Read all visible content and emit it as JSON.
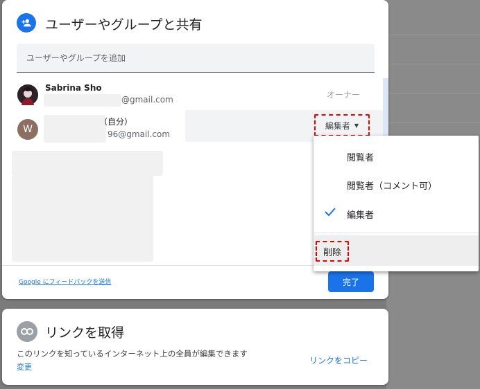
{
  "share_dialog": {
    "title": "ユーザーやグループと共有",
    "add_placeholder": "ユーザーやグループを追加",
    "people": [
      {
        "name": "Sabrina Sho",
        "email_suffix": "@gmail.com",
        "role": "オーナー"
      },
      {
        "avatar_letter": "W",
        "self_label": "（自分）",
        "email_suffix": "96@gmail.com",
        "role": "編集者"
      }
    ],
    "feedback_link": "Google にフィードバックを送信",
    "done_button": "完了"
  },
  "role_menu": {
    "items": [
      {
        "label": "閲覧者",
        "checked": false
      },
      {
        "label": "閲覧者（コメント可）",
        "checked": false
      },
      {
        "label": "編集者",
        "checked": true
      }
    ],
    "remove_label": "削除"
  },
  "link_card": {
    "title": "リンクを取得",
    "description": "このリンクを知っているインターネット上の全員が編集できます",
    "change_link": "変更",
    "copy_link": "リンクをコピー"
  },
  "colors": {
    "accent": "#1a73e8",
    "annotation": "#e00000",
    "overlay": "#7b7b7b"
  }
}
